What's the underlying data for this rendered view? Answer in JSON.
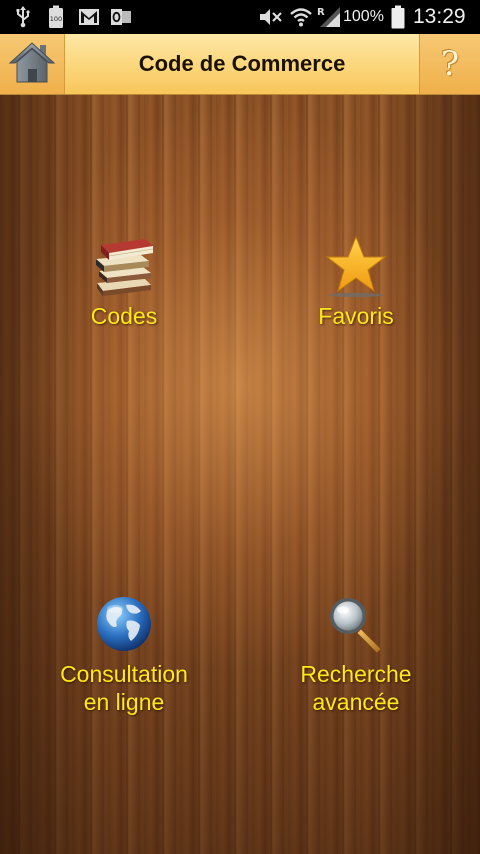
{
  "status_bar": {
    "icons": [
      "usb-icon",
      "battery-100-notification-icon",
      "gmail-icon",
      "outlook-icon",
      "mute-icon",
      "wifi-icon",
      "roaming-signal-icon",
      "battery-icon"
    ],
    "battery_percent": "100%",
    "time": "13:29"
  },
  "title_bar": {
    "home_icon": "home-icon",
    "title": "Code de Commerce",
    "help_glyph": "?"
  },
  "menu": {
    "codes": {
      "label": "Codes",
      "icon": "books-icon"
    },
    "favoris": {
      "label": "Favoris",
      "icon": "star-icon"
    },
    "consultation": {
      "label_line1": "Consultation",
      "label_line2": "en ligne",
      "icon": "globe-icon"
    },
    "recherche": {
      "label_line1": "Recherche",
      "label_line2": "avancée",
      "icon": "magnifier-icon"
    }
  },
  "colors": {
    "label_yellow": "#ffe81a",
    "title_bar_gold": "#fbd67a",
    "wood_brown": "#8f5426"
  }
}
